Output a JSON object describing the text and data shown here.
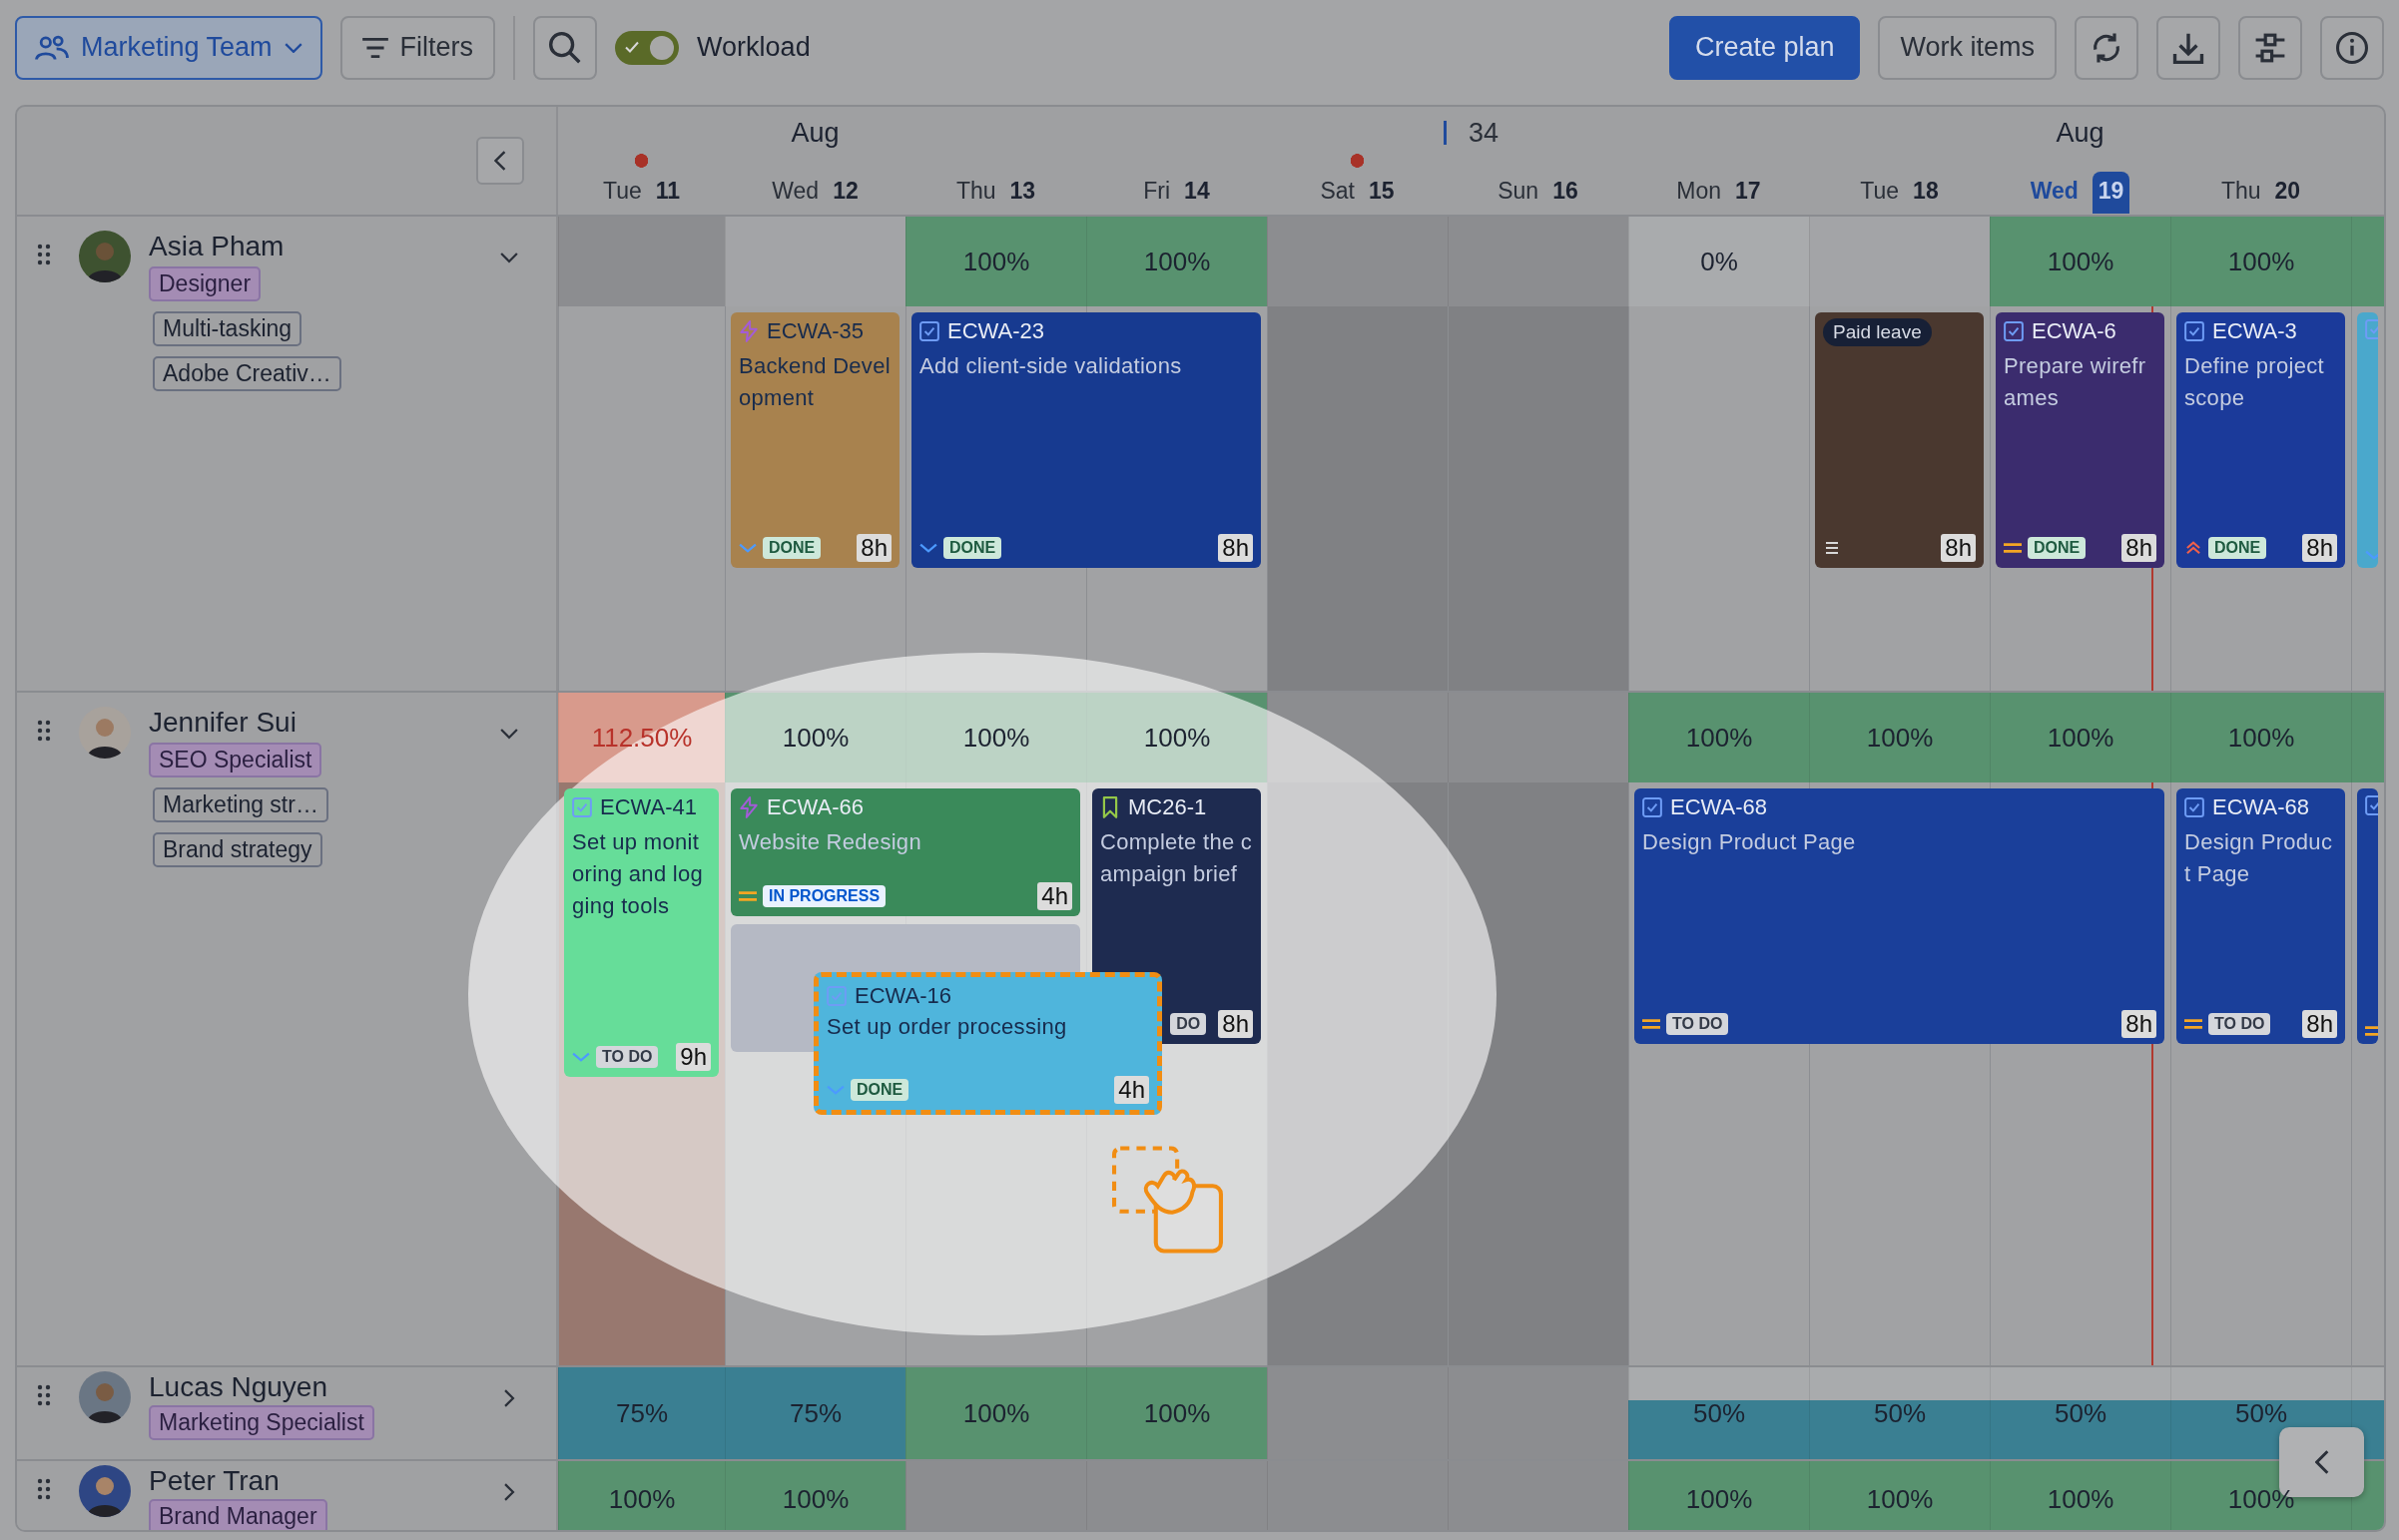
{
  "toolbar": {
    "team": "Marketing Team",
    "filters": "Filters",
    "workload": {
      "label": "Workload",
      "on": true
    },
    "primary": "Create plan",
    "secondary": "Work items"
  },
  "timeline": {
    "days": [
      {
        "weekday": "Tue",
        "day": "11",
        "holiday": true,
        "weekend": false,
        "today": false
      },
      {
        "weekday": "Wed",
        "day": "12",
        "holiday": false,
        "weekend": false,
        "today": false,
        "month": "Aug"
      },
      {
        "weekday": "Thu",
        "day": "13",
        "holiday": false,
        "weekend": false,
        "today": false
      },
      {
        "weekday": "Fri",
        "day": "14",
        "holiday": false,
        "weekend": false,
        "today": false
      },
      {
        "weekday": "Sat",
        "day": "15",
        "holiday": true,
        "weekend": true,
        "today": false
      },
      {
        "weekday": "Sun",
        "day": "16",
        "holiday": false,
        "weekend": true,
        "today": false,
        "week": "34"
      },
      {
        "weekday": "Mon",
        "day": "17",
        "holiday": false,
        "weekend": false,
        "today": false
      },
      {
        "weekday": "Tue",
        "day": "18",
        "holiday": false,
        "weekend": false,
        "today": false
      },
      {
        "weekday": "Wed",
        "day": "19",
        "holiday": false,
        "weekend": false,
        "today": true,
        "month": "Aug"
      },
      {
        "weekday": "Thu",
        "day": "20",
        "holiday": false,
        "weekend": false,
        "today": false
      }
    ],
    "people": [
      {
        "name": "Asia Pham",
        "role": "Designer",
        "skills": [
          "Multi-tasking",
          "Adobe Creativ…"
        ],
        "expanded": true,
        "days": [
          {
            "kind": "none"
          },
          {
            "kind": "empty",
            "tasks": [
              {
                "kind": "issue",
                "type": {
                  "kind": "story"
                },
                "color": "#a8824e",
                "key": "ECWA-35",
                "title": "Backend Development",
                "priority": {
                  "kind": "low"
                },
                "status": {
                  "text": "DONE",
                  "kind": "done"
                },
                "hours": "8h",
                "span": {
                  "kind": "one"
                },
                "size": {
                  "kind": "normal"
                }
              }
            ]
          },
          {
            "load": "100%",
            "kind": "ok",
            "tasks": [
              {
                "kind": "issue",
                "type": {
                  "kind": "task"
                },
                "color": "#173a90",
                "key": "ECWA-23",
                "title": "Add client-side validations",
                "priority": {
                  "kind": "low"
                },
                "status": {
                  "text": "DONE",
                  "kind": "done"
                },
                "hours": "8h",
                "span": {
                  "kind": "two"
                },
                "size": {
                  "kind": "normal"
                }
              }
            ]
          },
          {
            "load": "100%",
            "kind": "ok"
          },
          {
            "kind": "none"
          },
          {
            "kind": "none"
          },
          {
            "load": "0%",
            "kind": "zero"
          },
          {
            "kind": "empty",
            "tasks": [
              {
                "kind": "leave",
                "color": "#4a382f",
                "title": "Paid leave",
                "priority": {
                  "kind": "lines"
                },
                "hours": "8h",
                "span": {
                  "kind": "one"
                },
                "size": {
                  "kind": "normal"
                }
              }
            ]
          },
          {
            "load": "100%",
            "kind": "ok",
            "tasks": [
              {
                "kind": "issue",
                "type": {
                  "kind": "task"
                },
                "color": "#3b2c6e",
                "key": "ECWA-6",
                "title": "Prepare wireframes",
                "priority": {
                  "kind": "medium"
                },
                "status": {
                  "text": "DONE",
                  "kind": "done"
                },
                "hours": "8h",
                "span": {
                  "kind": "one"
                },
                "size": {
                  "kind": "normal"
                }
              }
            ]
          },
          {
            "load": "100%",
            "kind": "ok",
            "tasks": [
              {
                "kind": "issue",
                "type": {
                  "kind": "task"
                },
                "color": "#1b3a9a",
                "key": "ECWA-3",
                "title": "Define project scope",
                "priority": {
                  "kind": "high"
                },
                "status": {
                  "text": "DONE",
                  "kind": "done"
                },
                "hours": "8h",
                "span": {
                  "kind": "one"
                },
                "size": {
                  "kind": "normal"
                }
              }
            ]
          },
          {
            "kind": "ok",
            "tasks": [
              {
                "kind": "cut",
                "type": {
                  "kind": "task"
                },
                "color": "#4aa8cc",
                "priority": {
                  "kind": "low"
                },
                "span": {
                  "kind": "one"
                },
                "size": {
                  "kind": "normal"
                }
              }
            ]
          }
        ]
      },
      {
        "name": "Jennifer Sui",
        "role": "SEO Specialist",
        "skills": [
          "Marketing str…",
          "Brand strategy"
        ],
        "expanded": true,
        "days": [
          {
            "load": "112.50%",
            "kind": "over",
            "tasks": [
              {
                "kind": "issue",
                "type": {
                  "kind": "task"
                },
                "color": "#66dd99",
                "key": "ECWA-41",
                "title": "Set up monitoring and logging tools",
                "priority": {
                  "kind": "low"
                },
                "status": {
                  "text": "TO DO",
                  "kind": "todo"
                },
                "hours": "9h",
                "span": {
                  "kind": "one"
                },
                "size": {
                  "kind": "tall"
                }
              }
            ]
          },
          {
            "load": "100%",
            "kind": "ok",
            "tasks": [
              {
                "kind": "issue",
                "type": {
                  "kind": "story"
                },
                "color": "#3a8a5a",
                "key": "ECWA-66",
                "title": "Website Redesign",
                "priority": {
                  "kind": "medium"
                },
                "status": {
                  "text": "IN PROGRESS",
                  "kind": "progress"
                },
                "hours": "4h",
                "span": {
                  "kind": "two"
                },
                "size": {
                  "kind": "short"
                }
              },
              {
                "kind": "slot",
                "color": "#b5b9c4",
                "span": {
                  "kind": "two"
                },
                "size": {
                  "kind": "short"
                }
              }
            ]
          },
          {
            "load": "100%",
            "kind": "ok"
          },
          {
            "load": "100%",
            "kind": "ok",
            "tasks": [
              {
                "kind": "issue",
                "type": {
                  "kind": "milestone"
                },
                "color": "#1e2b50",
                "key": "MC26-1",
                "title": "Complete the campaign brief",
                "status": {
                  "text": "DO",
                  "kind": "todo"
                },
                "hours": "8h",
                "span": {
                  "kind": "one"
                },
                "size": {
                  "kind": "normal"
                }
              }
            ]
          },
          {
            "kind": "none"
          },
          {
            "kind": "none"
          },
          {
            "load": "100%",
            "kind": "ok",
            "tasks": [
              {
                "kind": "issue",
                "type": {
                  "kind": "task"
                },
                "color": "#1a3f9a",
                "key": "ECWA-68",
                "title": "Design Product Page",
                "priority": {
                  "kind": "medium"
                },
                "status": {
                  "text": "TO DO",
                  "kind": "todo"
                },
                "hours": "8h",
                "span": {
                  "kind": "three"
                },
                "size": {
                  "kind": "normal"
                }
              }
            ]
          },
          {
            "load": "100%",
            "kind": "ok"
          },
          {
            "load": "100%",
            "kind": "ok"
          },
          {
            "load": "100%",
            "kind": "ok",
            "tasks": [
              {
                "kind": "issue",
                "type": {
                  "kind": "task"
                },
                "color": "#1a3f9a",
                "key": "ECWA-68",
                "title": "Design Product Page",
                "priority": {
                  "kind": "medium"
                },
                "status": {
                  "text": "TO DO",
                  "kind": "todo"
                },
                "hours": "8h",
                "span": {
                  "kind": "one"
                },
                "size": {
                  "kind": "normal"
                }
              }
            ]
          },
          {
            "kind": "ok",
            "tasks": [
              {
                "kind": "cut",
                "type": {
                  "kind": "task"
                },
                "color": "#1a3f9a",
                "priority": {
                  "kind": "medium"
                },
                "span": {
                  "kind": "one"
                },
                "size": {
                  "kind": "normal"
                }
              }
            ]
          }
        ],
        "dragging": {
          "type": {
            "kind": "task"
          },
          "color": "#4fb5dc",
          "key": "ECWA-16",
          "title": "Set up order processing",
          "priority": {
            "kind": "low"
          },
          "status": {
            "text": "DONE",
            "kind": "done"
          },
          "hours": "4h"
        }
      },
      {
        "name": "Lucas Nguyen",
        "role": "Marketing Specialist",
        "expanded": false,
        "days": [
          {
            "load": "75%",
            "kind": "part"
          },
          {
            "load": "75%",
            "kind": "part"
          },
          {
            "load": "100%",
            "kind": "ok"
          },
          {
            "load": "100%",
            "kind": "ok"
          },
          {
            "kind": "none"
          },
          {
            "kind": "none"
          },
          {
            "load": "50%",
            "kind": "half"
          },
          {
            "load": "50%",
            "kind": "half"
          },
          {
            "load": "50%",
            "kind": "half"
          },
          {
            "load": "50%",
            "kind": "half"
          },
          {
            "kind": "half"
          }
        ]
      },
      {
        "name": "Peter Tran",
        "role": "Brand Manager",
        "expanded": false,
        "days": [
          {
            "load": "100%",
            "kind": "ok"
          },
          {
            "load": "100%",
            "kind": "ok"
          },
          {
            "kind": "none"
          },
          {
            "kind": "none"
          },
          {
            "kind": "none"
          },
          {
            "kind": "none"
          },
          {
            "load": "100%",
            "kind": "ok"
          },
          {
            "load": "100%",
            "kind": "ok"
          },
          {
            "load": "100%",
            "kind": "ok"
          },
          {
            "load": "100%",
            "kind": "ok"
          },
          {
            "kind": "ok"
          }
        ]
      }
    ]
  }
}
